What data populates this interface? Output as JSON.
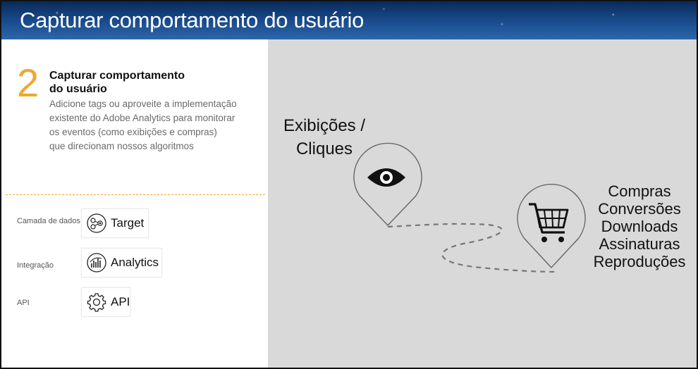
{
  "header": {
    "title": "Capturar comportamento do usuário"
  },
  "step": {
    "number": "2",
    "heading_line1": "Capturar comportamento",
    "heading_line2": "do usuário",
    "description_lines": [
      "Adicione tags ou aproveite a implementação",
      "existente do Adobe Analytics para monitorar",
      "os eventos (como exibições e compras)",
      "que direcionam nossos algoritmos"
    ]
  },
  "integrations": [
    {
      "label": "Camada de dados",
      "product": "Target",
      "icon": "target-icon"
    },
    {
      "label": "Integração",
      "product": "Analytics",
      "icon": "analytics-icon"
    },
    {
      "label": "API",
      "product": "API",
      "icon": "gear-icon"
    }
  ],
  "diagram": {
    "view_label_line1": "Exibições /",
    "view_label_line2": "Cliques",
    "view_icon": "eye-icon",
    "purchase_icon": "shopping-cart-icon",
    "outcomes": [
      "Compras",
      "Conversões",
      "Downloads",
      "Assinaturas",
      "Reproduções"
    ]
  },
  "colors": {
    "accent": "#f0a830",
    "header_bg": "#1a4d8f",
    "panel_bg": "#d9d9d9"
  }
}
